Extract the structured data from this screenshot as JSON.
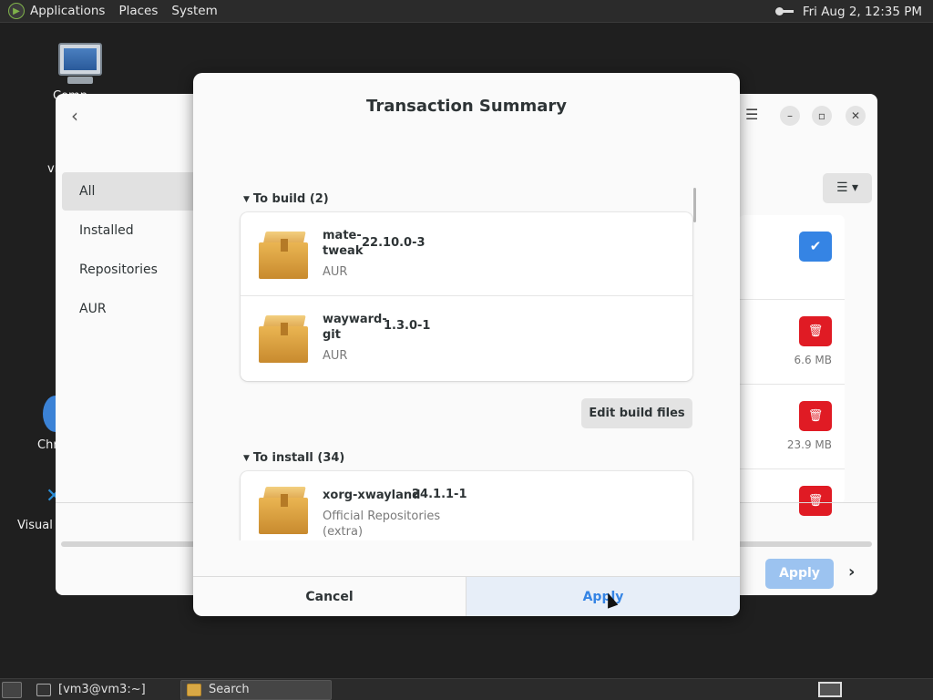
{
  "top_panel": {
    "menus": [
      "Applications",
      "Places",
      "System"
    ],
    "clock": "Fri Aug  2, 12:35 PM"
  },
  "desktop": {
    "icons": [
      {
        "label": "Comp"
      },
      {
        "label": "vm"
      },
      {
        "label": "Chr"
      },
      {
        "label": "Visual S"
      }
    ]
  },
  "background_window": {
    "sidebar": [
      "All",
      "Installed",
      "Repositories",
      "AUR"
    ],
    "sizes": [
      "6.6 MB",
      "23.9 MB"
    ],
    "apply_label": "Apply",
    "view_icon": "list-icon"
  },
  "dialog": {
    "title": "Transaction Summary",
    "sections": [
      {
        "header": "To build (2)",
        "packages": [
          {
            "name_line1": "mate-",
            "name_line2": "tweak",
            "version": "22.10.0-3",
            "repo": "AUR"
          },
          {
            "name_line1": "wayward-",
            "name_line2": "git",
            "version": "1.3.0-1",
            "repo": "AUR"
          }
        ]
      },
      {
        "header": "To install (34)",
        "packages": [
          {
            "name_line1": "xorg-xwayland",
            "version": "24.1.1-1",
            "repo_line1": "Official Repositories",
            "repo_line2": "(extra)"
          }
        ]
      }
    ],
    "edit_build_label": "Edit build files",
    "cancel_label": "Cancel",
    "apply_label": "Apply"
  },
  "taskbar": {
    "tasks": [
      "[vm3@vm3:~]",
      "Search"
    ]
  },
  "colors": {
    "accent": "#3584e4",
    "danger": "#e01b24",
    "panel": "#2b2b2b"
  }
}
